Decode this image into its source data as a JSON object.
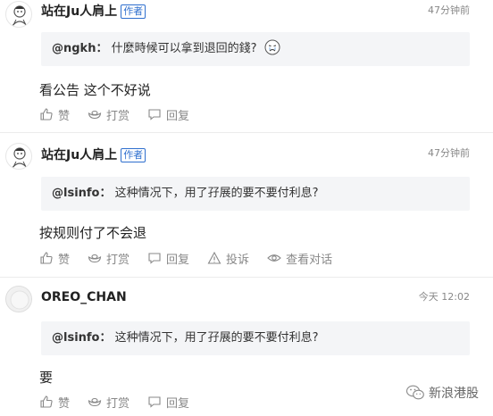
{
  "comments": [
    {
      "username": "站在Ju人肩上",
      "badge": "作者",
      "time": "47分钟前",
      "quote_user": "@ngkh：",
      "quote_text": "什麼時候可以拿到退回的錢?",
      "body": "看公告 这个不好说",
      "actions": {
        "like": "赞",
        "tip": "打赏",
        "reply": "回复"
      },
      "avatar_icon": "cartoon-avatar"
    },
    {
      "username": "站在Ju人肩上",
      "badge": "作者",
      "time": "47分钟前",
      "quote_user": "@lsinfo：",
      "quote_text": "这种情况下，用了孖展的要不要付利息?",
      "body": "按规则付了不会退",
      "actions": {
        "like": "赞",
        "tip": "打赏",
        "reply": "回复",
        "report": "投诉",
        "view": "查看对话"
      },
      "avatar_icon": "cartoon-avatar"
    },
    {
      "username": "OREO_CHAN",
      "time": "今天 12:02",
      "quote_user": "@lsinfo：",
      "quote_text": "这种情况下，用了孖展的要不要付利息?",
      "body": "要",
      "actions": {
        "like": "赞",
        "tip": "打赏",
        "reply": "回复"
      },
      "avatar_icon": "default-avatar"
    }
  ],
  "watermark": {
    "text": "新浪港股",
    "icon": "wechat-icon"
  },
  "colors": {
    "badge": "#2f6fce",
    "quote_bg": "#f4f5f7",
    "meta": "#888888"
  }
}
